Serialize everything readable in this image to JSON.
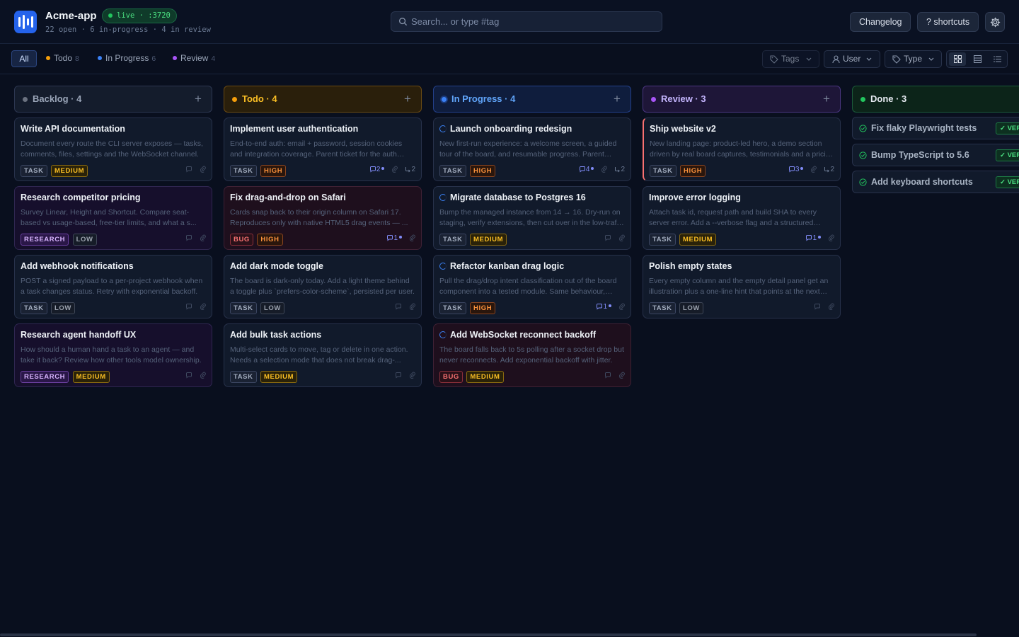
{
  "app": {
    "name": "Acme-app",
    "live_badge": "live · :3720",
    "counts_line": "22 open · 6 in-progress · 4 in review"
  },
  "search": {
    "placeholder": "Search... or type #tag"
  },
  "header_buttons": {
    "changelog": "Changelog",
    "shortcuts": "? shortcuts"
  },
  "filter_tabs": [
    {
      "label": "All",
      "count": "",
      "color": ""
    },
    {
      "label": "Todo",
      "count": "8",
      "color": "#f59e0b"
    },
    {
      "label": "In Progress",
      "count": "6",
      "color": "#3b82f6"
    },
    {
      "label": "Review",
      "count": "4",
      "color": "#a855f7"
    }
  ],
  "filters": {
    "tags": "Tags",
    "user": "User",
    "type": "Type"
  },
  "icons": {
    "logo": "logo-icon",
    "search": "search-icon",
    "gear": "gear-icon",
    "tag": "tag-icon",
    "user": "user-icon",
    "grid_view": "grid-view-icon",
    "table_view": "table-view-icon",
    "list_view": "list-view-icon",
    "comment": "comment-icon",
    "attachment": "paperclip-icon",
    "subtask": "subtask-icon",
    "check": "check-circle-icon",
    "progress": "progress-spinner-icon",
    "add": "plus-icon"
  },
  "columns": [
    {
      "title": "Backlog · 4",
      "dot": "#6b7280",
      "head_bg": "#141c2c",
      "head_border": "#2c3650",
      "head_color": "#9aa5b8",
      "cards": [
        {
          "title": "Write API documentation",
          "desc": "Document every route the CLI server exposes — tasks, comments, files, settings and the WebSocket channel.",
          "type": "TASK",
          "priority": "MEDIUM",
          "style": "",
          "comments": "",
          "subtasks": ""
        },
        {
          "title": "Research competitor pricing",
          "desc": "Survey Linear, Height and Shortcut. Compare seat-based vs usage-based, free-tier limits, and what a s...",
          "type": "RESEARCH",
          "priority": "LOW",
          "style": "research",
          "comments": "",
          "subtasks": ""
        },
        {
          "title": "Add webhook notifications",
          "desc": "POST a signed payload to a per-project webhook when a task changes status. Retry with exponential backoff.",
          "type": "TASK",
          "priority": "LOW",
          "style": "",
          "comments": "",
          "subtasks": ""
        },
        {
          "title": "Research agent handoff UX",
          "desc": "How should a human hand a task to an agent — and take it back? Review how other tools model ownership.",
          "type": "RESEARCH",
          "priority": "MEDIUM",
          "style": "research",
          "comments": "",
          "subtasks": ""
        }
      ]
    },
    {
      "title": "Todo · 4",
      "dot": "#f59e0b",
      "head_bg": "#2a1f0b",
      "head_border": "#6a4a12",
      "head_color": "#fbbf24",
      "cards": [
        {
          "title": "Implement user authentication",
          "desc": "End-to-end auth: email + password, session cookies and integration coverage. Parent ticket for the auth work.",
          "type": "TASK",
          "priority": "HIGH",
          "style": "",
          "comments": "2",
          "subtasks": "2"
        },
        {
          "title": "Fix drag-and-drop on Safari",
          "desc": "Cards snap back to their origin column on Safari 17. Reproduces only with native HTML5 drag events — ...",
          "type": "BUG",
          "priority": "HIGH",
          "style": "bug",
          "comments": "1",
          "subtasks": ""
        },
        {
          "title": "Add dark mode toggle",
          "desc": "The board is dark-only today. Add a light theme behind a toggle plus `prefers-color-scheme`, persisted per user.",
          "type": "TASK",
          "priority": "LOW",
          "style": "",
          "comments": "",
          "subtasks": ""
        },
        {
          "title": "Add bulk task actions",
          "desc": "Multi-select cards to move, tag or delete in one action. Needs a selection mode that does not break drag-...",
          "type": "TASK",
          "priority": "MEDIUM",
          "style": "",
          "comments": "",
          "subtasks": ""
        }
      ]
    },
    {
      "title": "In Progress · 4",
      "dot": "#3b82f6",
      "head_bg": "#0f1d3d",
      "head_border": "#23408a",
      "head_color": "#60a5fa",
      "cards": [
        {
          "title": "Launch onboarding redesign",
          "desc": "New first-run experience: a welcome screen, a guided tour of the board, and resumable progress. Parent ticket.",
          "type": "TASK",
          "priority": "HIGH",
          "style": "",
          "comments": "4",
          "subtasks": "2",
          "spinner": true
        },
        {
          "title": "Migrate database to Postgres 16",
          "desc": "Bump the managed instance from 14 → 16. Dry-run on staging, verify extensions, then cut over in the low-traffic window.",
          "type": "TASK",
          "priority": "MEDIUM",
          "style": "",
          "comments": "",
          "subtasks": "",
          "spinner": true
        },
        {
          "title": "Refactor kanban drag logic",
          "desc": "Pull the drag/drop intent classification out of the board component into a tested module. Same behaviour, better tests.",
          "type": "TASK",
          "priority": "HIGH",
          "style": "",
          "comments": "1",
          "subtasks": "",
          "spinner": true
        },
        {
          "title": "Add WebSocket reconnect backoff",
          "desc": "The board falls back to 5s polling after a socket drop but never reconnects. Add exponential backoff with jitter.",
          "type": "BUG",
          "priority": "MEDIUM",
          "style": "bug",
          "comments": "",
          "subtasks": "",
          "spinner": true
        }
      ]
    },
    {
      "title": "Review · 3",
      "dot": "#a855f7",
      "head_bg": "#1e1638",
      "head_border": "#4a3680",
      "head_color": "#c4b5fd",
      "cards": [
        {
          "title": "Ship website v2",
          "desc": "New landing page: product-led hero, a demo section driven by real board captures, testimonials and a pricing table.",
          "type": "TASK",
          "priority": "HIGH",
          "style": "active-left",
          "comments": "3",
          "subtasks": "2"
        },
        {
          "title": "Improve error logging",
          "desc": "Attach task id, request path and build SHA to every server error. Add a --verbose flag and a structured JSON mode.",
          "type": "TASK",
          "priority": "MEDIUM",
          "style": "",
          "comments": "1",
          "subtasks": ""
        },
        {
          "title": "Polish empty states",
          "desc": "Every empty column and the empty detail panel get an illustration plus a one-line hint that points at the next action.",
          "type": "TASK",
          "priority": "LOW",
          "style": "",
          "comments": "",
          "subtasks": ""
        }
      ]
    }
  ],
  "done_column": {
    "title": "Done · 3",
    "dot": "#22c55e",
    "head_bg": "#0c2419",
    "head_border": "#1b5a3a",
    "head_color": "#e5e9f0",
    "verified_label": "✓ VERIFIED",
    "cards": [
      {
        "title": "Fix flaky Playwright tests"
      },
      {
        "title": "Bump TypeScript to 5.6"
      },
      {
        "title": "Add keyboard shortcuts"
      }
    ]
  }
}
